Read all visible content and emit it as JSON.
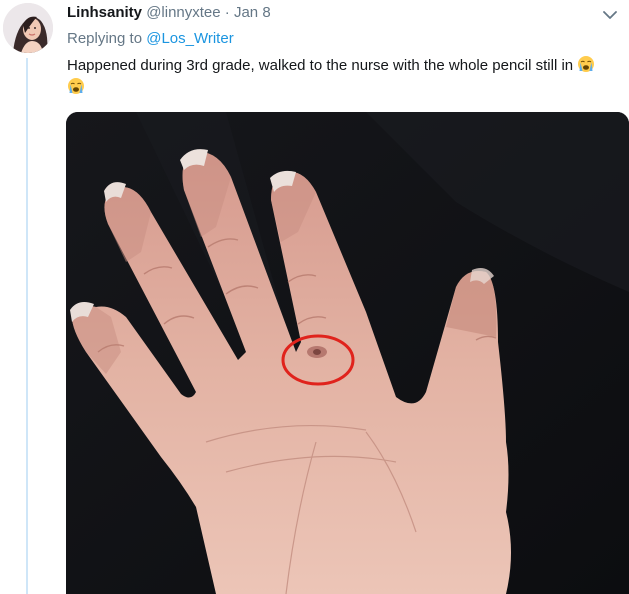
{
  "tweet": {
    "author": {
      "display_name": "Linhsanity",
      "handle": "@linnyxtee",
      "avatar_icon": "avatar-photo"
    },
    "separator": "·",
    "timestamp": "Jan 8",
    "reply": {
      "prefix": "Replying to",
      "mention": "@Los_Writer"
    },
    "text": "Happened during 3rd grade, walked to the nurse with the whole pencil still in",
    "emoji": [
      "loudly-crying-face-icon",
      "loudly-crying-face-icon"
    ],
    "media": {
      "kind": "photo",
      "subject": "hand-photo",
      "highlight_color": "#e0231c"
    },
    "menu_icon": "chevron-down-icon"
  },
  "colors": {
    "thread_line": "#cfe6f8",
    "link": "#1b95e0",
    "secondary_text": "#657786",
    "primary_text": "#14171a"
  }
}
